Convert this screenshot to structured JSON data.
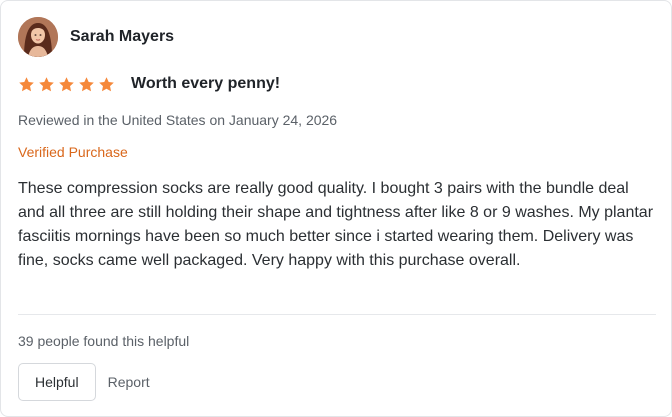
{
  "review": {
    "author_name": "Sarah Mayers",
    "rating": 5,
    "rating_max": 5,
    "title": "Worth every penny!",
    "meta": "Reviewed in the United States on January 24, 2026",
    "verified_label": "Verified Purchase",
    "body": "These compression socks are really good quality. I bought 3 pairs with the bundle deal and all three are still holding their shape and tightness after like 8 or 9 washes. My plantar fasciitis mornings have been so much better since i started wearing them. Delivery was fine, socks came well packaged. Very happy with this purchase overall.",
    "helpful_count_text": "39 people found this helpful"
  },
  "actions": {
    "helpful_label": "Helpful",
    "report_label": "Report"
  },
  "colors": {
    "star": "#f5883a",
    "verified": "#d9671b",
    "text": "#1f2328",
    "muted": "#5b6168"
  },
  "icons": {
    "avatar": "user-avatar",
    "star": "star-icon"
  }
}
